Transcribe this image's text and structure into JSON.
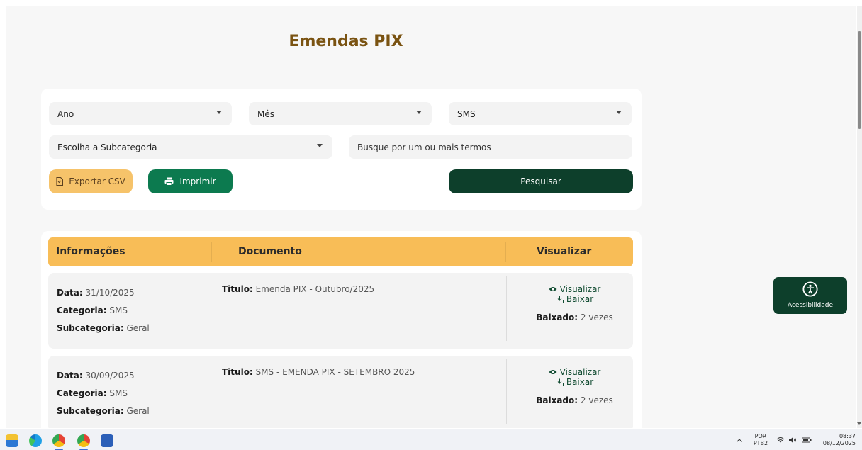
{
  "page": {
    "title": "Emendas PIX"
  },
  "filters": {
    "year": {
      "label": "Ano"
    },
    "month": {
      "label": "Mês"
    },
    "category": {
      "value": "SMS"
    },
    "subcategory": {
      "label": "Escolha a Subcategoria"
    },
    "search": {
      "placeholder": "Busque por um ou mais termos"
    },
    "buttons": {
      "export": "Exportar CSV",
      "print": "Imprimir",
      "search": "Pesquisar"
    }
  },
  "table": {
    "headers": [
      "Informações",
      "Documento",
      "Visualizar"
    ],
    "rows": [
      {
        "date_label": "Data:",
        "date": "31/10/2025",
        "category_label": "Categoria:",
        "category": "SMS",
        "subcategory_label": "Subcategoria:",
        "subcategory": "Geral",
        "title_label": "Titulo:",
        "title": "Emenda PIX - Outubro/2025",
        "view": "Visualizar",
        "download": "Baixar",
        "downloads_label": "Baixado:",
        "downloads": "2 vezes"
      },
      {
        "date_label": "Data:",
        "date": "30/09/2025",
        "category_label": "Categoria:",
        "category": "SMS",
        "subcategory_label": "Subcategoria:",
        "subcategory": "Geral",
        "title_label": "Titulo:",
        "title": "SMS - EMENDA PIX - SETEMBRO 2025",
        "view": "Visualizar",
        "download": "Baixar",
        "downloads_label": "Baixado:",
        "downloads": "2 vezes"
      }
    ]
  },
  "accessibility": {
    "label": "Acessibilidade"
  },
  "taskbar": {
    "language": "POR",
    "layout": "PTB2",
    "time": "08:37",
    "date": "08/12/2025",
    "apps": [
      "file-explorer-icon",
      "edge-icon",
      "chrome-icon",
      "chrome-profile-icon",
      "word-icon"
    ]
  },
  "colors": {
    "title": "#7a5312",
    "header": "#f8bd57",
    "primary_dark": "#0d3f2b",
    "primary": "#0c7a4f",
    "export": "#f6c36a"
  }
}
